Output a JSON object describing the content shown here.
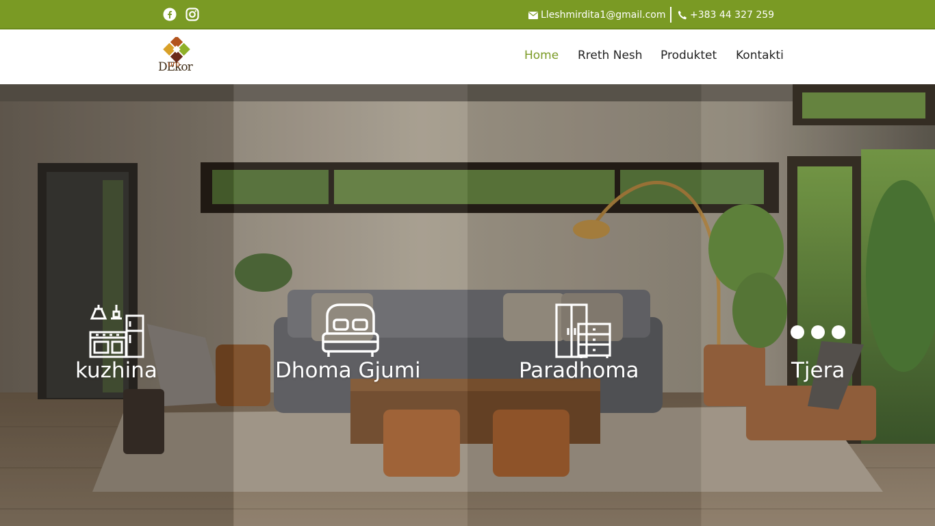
{
  "topbar": {
    "email": "Lleshmirdita1@gmail.com",
    "phone": "+383 44 327 259",
    "social": [
      "facebook-icon",
      "instagram-icon"
    ]
  },
  "logo": {
    "text": "DEkor",
    "sub": "uro"
  },
  "nav": {
    "items": [
      {
        "label": "Home",
        "active": true
      },
      {
        "label": "Rreth Nesh",
        "active": false
      },
      {
        "label": "Produktet",
        "active": false
      },
      {
        "label": "Kontakti",
        "active": false
      }
    ]
  },
  "hero": {
    "panels": [
      {
        "label": "kuzhina",
        "icon": "kitchen-icon"
      },
      {
        "label": "Dhoma Gjumi",
        "icon": "bed-icon"
      },
      {
        "label": "Paradhoma",
        "icon": "wardrobe-icon"
      },
      {
        "label": "Tjera",
        "icon": "dots-icon"
      }
    ]
  },
  "colors": {
    "brand_green": "#7a9a24",
    "nav_text": "#222222",
    "white": "#ffffff"
  }
}
